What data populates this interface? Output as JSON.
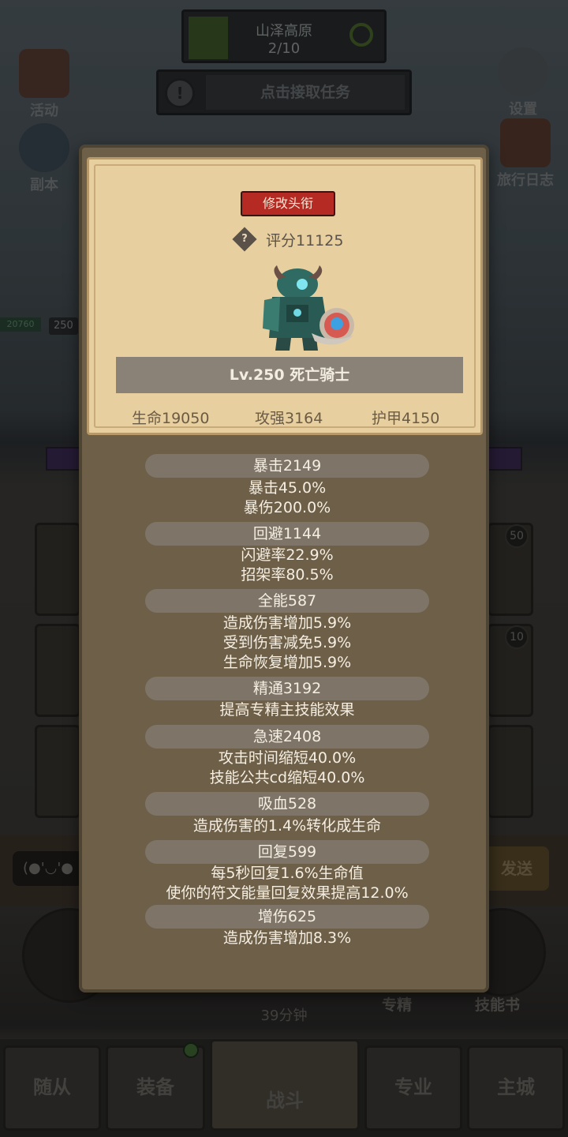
{
  "background": {
    "area_name": "山泽高原",
    "area_progress": "2/10",
    "quest_text": "点击接取任务",
    "left_buttons": [
      "活动",
      "副本"
    ],
    "right_buttons": [
      "设置",
      "旅行日志"
    ],
    "level_tag": "250",
    "hp_tag": "20760",
    "slot_badges": [
      "50",
      "10"
    ],
    "chat_bubble": "(●'◡'●",
    "send_label": "发送",
    "timer": "39分钟",
    "skill_labels": [
      "专精",
      "技能书"
    ]
  },
  "nav": {
    "tabs": [
      "随从",
      "装备",
      "战斗",
      "专业",
      "主城"
    ],
    "active": "战斗"
  },
  "popup": {
    "change_title_label": "修改头衔",
    "score_icon": "?",
    "score": "评分11125",
    "hero_name": "Lv.250 死亡骑士",
    "base_stats": [
      "生命19050",
      "攻强3164",
      "护甲4150"
    ],
    "stat_groups": [
      {
        "header": "暴击2149",
        "lines": [
          "暴击45.0%",
          "暴伤200.0%"
        ]
      },
      {
        "header": "回避1144",
        "lines": [
          "闪避率22.9%",
          "招架率80.5%"
        ]
      },
      {
        "header": "全能587",
        "lines": [
          "造成伤害增加5.9%",
          "受到伤害减免5.9%",
          "生命恢复增加5.9%"
        ]
      },
      {
        "header": "精通3192",
        "lines": [
          "提高专精主技能效果"
        ]
      },
      {
        "header": "急速2408",
        "lines": [
          "攻击时间缩短40.0%",
          "技能公共cd缩短40.0%"
        ]
      },
      {
        "header": "吸血528",
        "lines": [
          "造成伤害的1.4%转化成生命"
        ]
      },
      {
        "header": "回复599",
        "lines": [
          "每5秒回复1.6%生命值",
          "使你的符文能量回复效果提高12.0%"
        ]
      },
      {
        "header": "增伤625",
        "lines": [
          "造成伤害增加8.3%"
        ]
      }
    ]
  },
  "colors": {
    "popup_bg": "#6e6048",
    "card_bg": "#e8cfa0",
    "title_button": "#b52a22",
    "stat_pill": "#7e7568"
  }
}
